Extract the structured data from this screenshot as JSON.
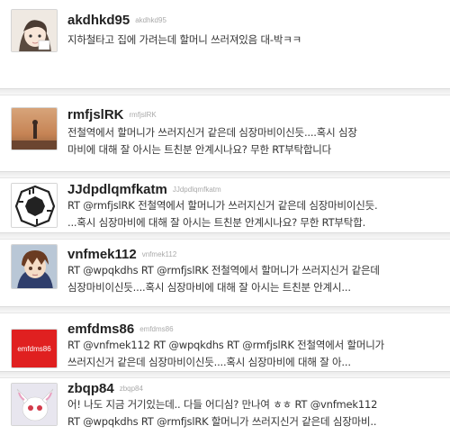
{
  "tweets": [
    {
      "user": "akdhkd95",
      "handle": "akdhkd95",
      "avatar": "anime-character-avatar",
      "lines": [
        "지하철타고 집에 가려는데 할머니 쓰러져있음 대-박ㅋㅋ"
      ]
    },
    {
      "user": "rmfjslRK",
      "handle": "rmfjslRK",
      "avatar": "sunset-figure-avatar",
      "lines": [
        "전철역에서 할머니가 쓰러지신거 같은데 심장마비이신듯....혹시 심장",
        "마비에 대해 잘 아시는 트친분 안계시나요? 무한 RT부탁합니다"
      ]
    },
    {
      "user": "JJdpdlqmfkatm",
      "handle": "JJdpdlqmfkatm",
      "avatar": "dharma-logo-avatar",
      "lines": [
        "RT @rmfjslRK 전철역에서 할머니가 쓰러지신거 같은데 심장마비이신듯.",
        "...혹시 심장마비에 대해 잘 아시는 트친분 안계시나요? 무한 RT부탁합."
      ]
    },
    {
      "user": "vnfmek112",
      "handle": "vnfmek112",
      "avatar": "anime-boy-avatar",
      "lines": [
        "RT @wpqkdhs RT @rmfjslRK 전철역에서 할머니가 쓰러지신거 같은데",
        "심장마비이신듯....혹시 심장마비에 대해 잘 아시는 트친분 안계시..."
      ]
    },
    {
      "user": "emfdms86",
      "handle": "emfdms86",
      "avatar": "emfdms86-red-avatar",
      "avatar_text": "emfdms86",
      "lines": [
        "RT @vnfmek112 RT @wpqkdhs RT @rmfjslRK 전철역에서 할머니가",
        "쓰러지신거 같은데 심장마비이신듯....혹시 심장마비에 대해 잘 아..."
      ]
    },
    {
      "user": "zbqp84",
      "handle": "zbqp84",
      "avatar": "white-creature-avatar",
      "lines": [
        "어! 나도 지금 거기있는데.. 다들 어디심? 만나여 ㅎㅎ RT @vnfmek112",
        "RT @wpqkdhs RT @rmfjslRK 할머니가 쓰러지신거 같은데 심장마비.."
      ]
    }
  ],
  "colors": {
    "username": "#222222",
    "handle": "#aaaaaa",
    "text": "#333333",
    "emfdms86_avatar_bg": "#e02020"
  }
}
